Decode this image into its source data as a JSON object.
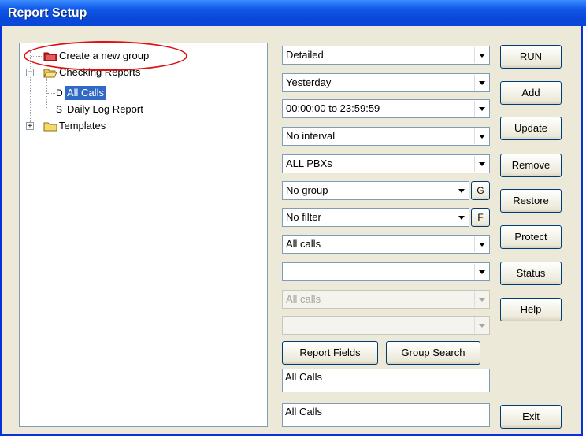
{
  "window": {
    "title": "Report Setup"
  },
  "tree": {
    "items": [
      {
        "label": "Create a new group",
        "icon": "red-folder-icon"
      },
      {
        "label": "Checking Reports",
        "icon": "open-folder-icon",
        "toggle": "−"
      },
      {
        "label": "All Calls",
        "prefix": "D",
        "selected": true
      },
      {
        "label": "Daily Log Report",
        "prefix": "S"
      },
      {
        "label": "Templates",
        "icon": "folder-icon",
        "toggle": "+"
      }
    ]
  },
  "options": {
    "report_type": "Detailed",
    "date_range": "Yesterday",
    "time_range": "00:00:00 to 23:59:59",
    "interval": "No interval",
    "pbx": "ALL PBXs",
    "group": "No group",
    "group_button": "G",
    "filter": "No filter",
    "filter_button": "F",
    "call_type": "All calls",
    "blank_select": "",
    "call_type_disabled": "All calls",
    "blank_select_disabled": ""
  },
  "buttons": {
    "report_fields": "Report Fields",
    "group_search": "Group Search",
    "run": "RUN",
    "add": "Add",
    "update": "Update",
    "remove": "Remove",
    "restore": "Restore",
    "protect": "Protect",
    "status": "Status",
    "help": "Help",
    "exit": "Exit"
  },
  "fields": {
    "report_name": "All Calls",
    "report_title": "All Calls"
  },
  "colors": {
    "titlebar": "#0a48d8",
    "highlight": "#316ac5",
    "annotation": "#e01010"
  }
}
